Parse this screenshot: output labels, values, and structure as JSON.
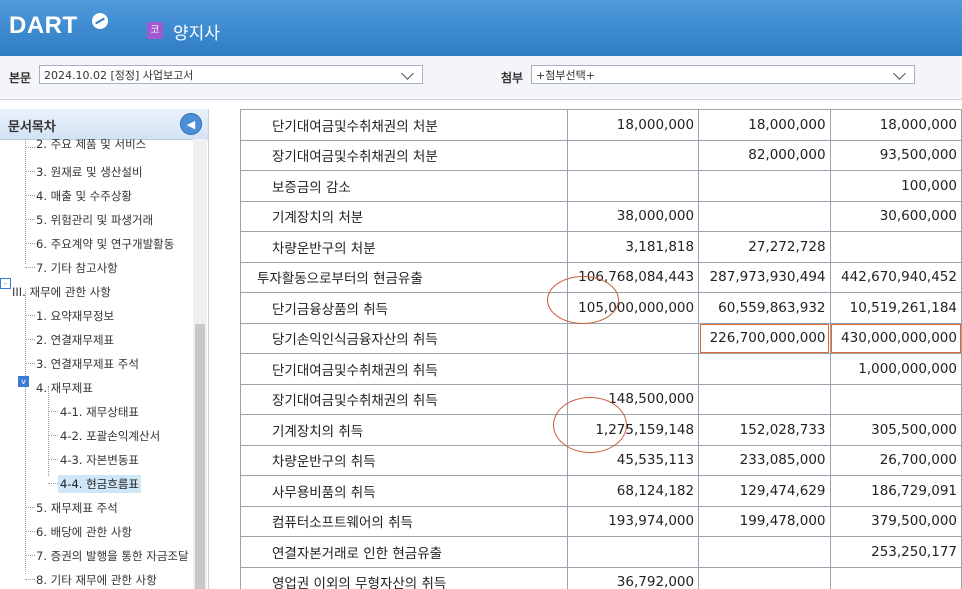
{
  "header": {
    "logo": "DART",
    "company_badge": "코",
    "company": "양지사"
  },
  "filters": {
    "report_label": "본문",
    "report_value": "2024.10.02 [정정] 사업보고서",
    "attach_label": "첨부",
    "attach_value": "+첨부선택+"
  },
  "sidebar": {
    "title": "문서목차",
    "items": [
      {
        "label": "2. 주요 제품 및 서비스",
        "level": 2
      },
      {
        "label": "3. 원재료 및 생산설비",
        "level": 2
      },
      {
        "label": "4. 매출 및 수주상황",
        "level": 2
      },
      {
        "label": "5. 위험관리 및 파생거래",
        "level": 2
      },
      {
        "label": "6. 주요계약 및 연구개발활동",
        "level": 2
      },
      {
        "label": "7. 기타 참고사항",
        "level": 2
      },
      {
        "label": "III. 재무에 관한 사항",
        "level": 1
      },
      {
        "label": "1. 요약재무정보",
        "level": 2
      },
      {
        "label": "2. 연결재무제표",
        "level": 2
      },
      {
        "label": "3. 연결재무제표 주석",
        "level": 2
      },
      {
        "label": "4. 재무제표",
        "level": 2
      },
      {
        "label": "4-1. 재무상태표",
        "level": 3
      },
      {
        "label": "4-2. 포괄손익계산서",
        "level": 3
      },
      {
        "label": "4-3. 자본변동표",
        "level": 3
      },
      {
        "label": "4-4. 현금흐름표",
        "level": 3
      },
      {
        "label": "5. 재무제표 주석",
        "level": 2
      },
      {
        "label": "6. 배당에 관한 사항",
        "level": 2
      },
      {
        "label": "7. 증권의 발행을 통한 자금조달",
        "level": 2
      },
      {
        "label": "8. 기타 재무에 관한 사항",
        "level": 2
      }
    ]
  },
  "table": {
    "rows": [
      {
        "label": "단기대여금및수취채권의 처분",
        "v1": "18,000,000",
        "v2": "18,000,000",
        "v3": "18,000,000"
      },
      {
        "label": "장기대여금및수취채권의 처분",
        "v1": "",
        "v2": "82,000,000",
        "v3": "93,500,000"
      },
      {
        "label": "보증금의 감소",
        "v1": "",
        "v2": "",
        "v3": "100,000"
      },
      {
        "label": "기계장치의 처분",
        "v1": "38,000,000",
        "v2": "",
        "v3": "30,600,000"
      },
      {
        "label": "차량운반구의 처분",
        "v1": "3,181,818",
        "v2": "27,272,728",
        "v3": ""
      },
      {
        "label": "투자활동으로부터의 현금유출",
        "v1": "106,768,084,443",
        "v2": "287,973,930,494",
        "v3": "442,670,940,452"
      },
      {
        "label": "단기금융상품의 취득",
        "v1": "105,000,000,000",
        "v2": "60,559,863,932",
        "v3": "10,519,261,184"
      },
      {
        "label": "당기손익인식금융자산의 취득",
        "v1": "",
        "v2": "226,700,000,000",
        "v3": "430,000,000,000"
      },
      {
        "label": "단기대여금및수취채권의 취득",
        "v1": "",
        "v2": "",
        "v3": "1,000,000,000"
      },
      {
        "label": "장기대여금및수취채권의 취득",
        "v1": "148,500,000",
        "v2": "",
        "v3": ""
      },
      {
        "label": "기계장치의 취득",
        "v1": "1,275,159,148",
        "v2": "152,028,733",
        "v3": "305,500,000"
      },
      {
        "label": "차량운반구의 취득",
        "v1": "45,535,113",
        "v2": "233,085,000",
        "v3": "26,700,000"
      },
      {
        "label": "사무용비품의 취득",
        "v1": "68,124,182",
        "v2": "129,474,629",
        "v3": "186,729,091"
      },
      {
        "label": "컴퓨터소프트웨어의 취득",
        "v1": "193,974,000",
        "v2": "199,478,000",
        "v3": "379,500,000"
      },
      {
        "label": "연결자본거래로 인한 현금유출",
        "v1": "",
        "v2": "",
        "v3": "253,250,177"
      },
      {
        "label": "영업권 이외의 무형자산의 취득",
        "v1": "36,792,000",
        "v2": "",
        "v3": ""
      }
    ]
  }
}
